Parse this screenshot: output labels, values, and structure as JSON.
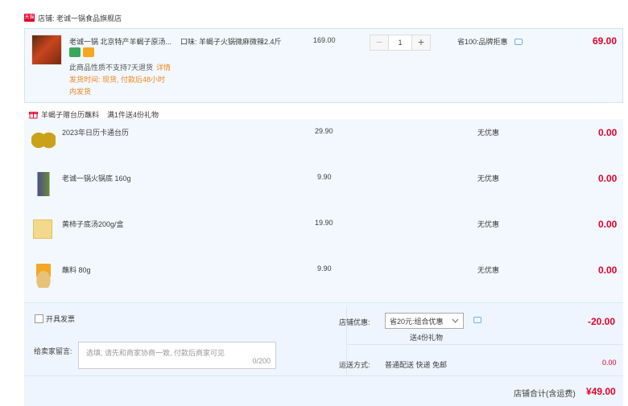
{
  "shop": {
    "badge": "天猫",
    "label": "店铺: 老诚一锅食品旗舰店"
  },
  "main_item": {
    "title": "老诚一锅 北京特产羊蝎子原汤...",
    "attr": "口味: 羊蝎子火锅微麻微辣2.4斤",
    "note": "此商品性质不支持7天退货",
    "detail_link": "详情",
    "ship_line1": "发货时间: 现货, 付款后48小时",
    "ship_line2": "内发货",
    "price": "169.00",
    "quantity": "1",
    "minus": "−",
    "plus": "+",
    "promo": "省100:品牌拒惠",
    "total": "69.00"
  },
  "gift": {
    "header": "羊蝎子赠台历蘸料",
    "rule": "满1件送4份礼物",
    "items": [
      {
        "name": "2023年日历卡通台历",
        "price": "29.90",
        "promo": "无优惠",
        "total": "0.00"
      },
      {
        "name": "老诚一锅火锅底 160g",
        "price": "9.90",
        "promo": "无优惠",
        "total": "0.00"
      },
      {
        "name": "黄柿子底汤200g/盒",
        "price": "19.90",
        "promo": "无优惠",
        "total": "0.00"
      },
      {
        "name": "蘸料 80g",
        "price": "9.90",
        "promo": "无优惠",
        "total": "0.00"
      }
    ]
  },
  "bottom": {
    "invoice_label": "开具发票",
    "message_label": "给卖家留言:",
    "message_placeholder": "选填, 请先和商家协商一致, 付款后商家可见",
    "message_count": "0/200",
    "shop_discount_label": "店铺优惠:",
    "shop_discount_select": "省20元:组合优惠",
    "shop_discount_sub": "送4份礼物",
    "shop_discount_value": "-20.00",
    "shipping_label": "运送方式:",
    "shipping_value": "普通配送 快递 免邮",
    "shipping_cost": "0.00",
    "store_total_label": "店铺合计(含运费)",
    "store_total_value": "¥49.00"
  },
  "colors": {
    "accent_red": "#e4002b",
    "orange": "#f0851a",
    "panel_bg": "#f3f8fe"
  }
}
